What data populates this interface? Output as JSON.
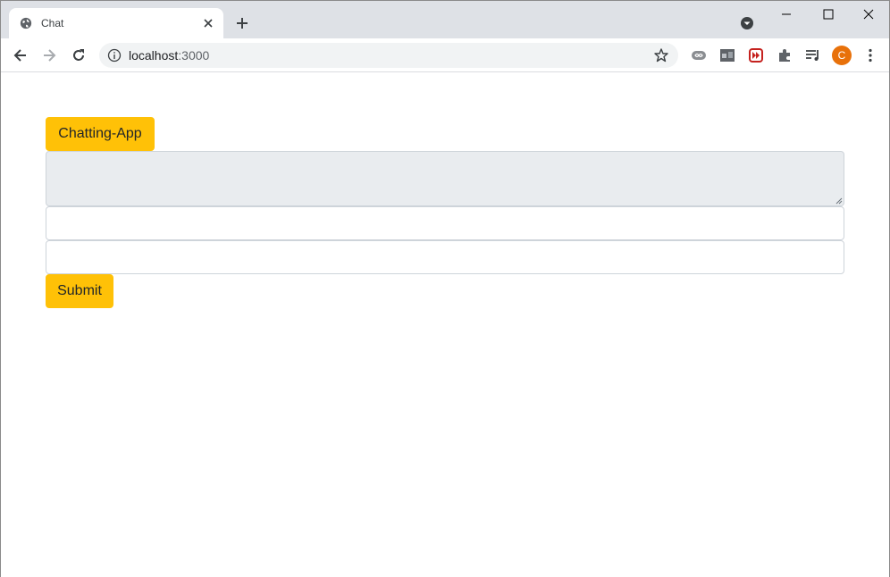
{
  "browser": {
    "tab": {
      "title": "Chat",
      "favicon": "globe-icon"
    },
    "address": {
      "host": "localhost",
      "port": ":3000"
    },
    "avatar_letter": "C"
  },
  "app": {
    "title_label": "Chatting-App",
    "messages_value": "",
    "input1": {
      "value": "",
      "placeholder": ""
    },
    "input2": {
      "value": "",
      "placeholder": ""
    },
    "submit_label": "Submit"
  },
  "colors": {
    "accent": "#ffc107",
    "readonly_bg": "#e9ecef",
    "border": "#ced4da"
  }
}
